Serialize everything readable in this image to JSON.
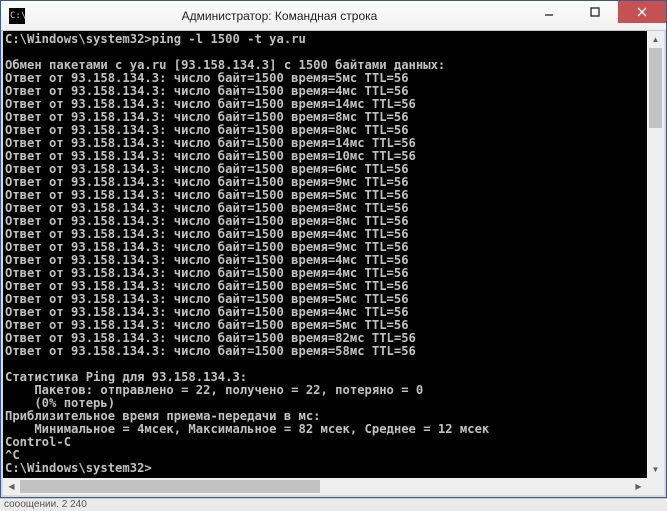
{
  "window": {
    "title": "Администратор: Командная строка",
    "icon_text": "C:\\"
  },
  "prompt_path": "C:\\Windows\\system32>",
  "command": "ping -l 1500 -t ya.ru",
  "ping_header": "Обмен пакетами с ya.ru [93.158.134.3] с 1500 байтами данных:",
  "reply_ip": "93.158.134.3",
  "reply_bytes": "1500",
  "reply_ttl": "56",
  "replies_times": [
    "5мс",
    "4мс",
    "14мс",
    "8мс",
    "8мс",
    "14мс",
    "10мс",
    "6мс",
    "9мс",
    "5мс",
    "8мс",
    "8мс",
    "4мс",
    "9мс",
    "4мс",
    "4мс",
    "5мс",
    "5мс",
    "4мс",
    "5мс",
    "82мс",
    "58мс"
  ],
  "stats": {
    "header": "Статистика Ping для 93.158.134.3:",
    "packets": "    Пакетов: отправлено = 22, получено = 22, потеряно = 0",
    "loss": "    (0% потерь)",
    "rtt_header": "Приблизительное время приема-передачи в мс:",
    "rtt": "    Минимальное = 4мсек, Максимальное = 82 мсек, Среднее = 12 мсек"
  },
  "ctrl_c": "Control-C",
  "caret_c": "^C",
  "final_prompt": "C:\\Windows\\system32>",
  "taskbar_fragment": "сооощении.   2 240"
}
